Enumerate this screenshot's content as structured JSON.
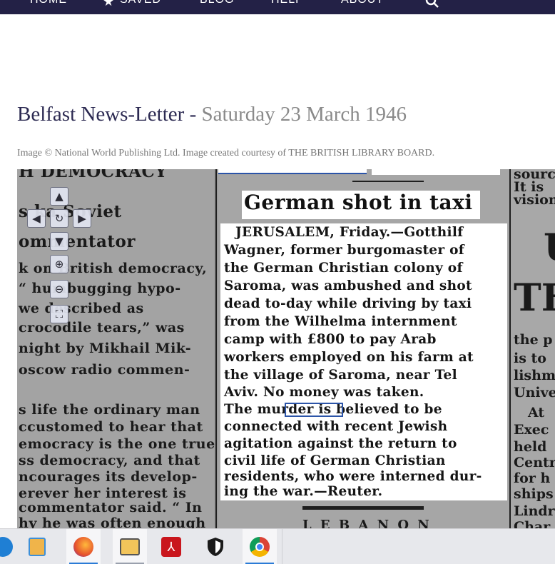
{
  "nav": {
    "items": [
      "HOME",
      "SAVED",
      "BLOG",
      "HELP",
      "ABOUT"
    ],
    "saved_icon": "star-icon",
    "search_icon": "search-icon"
  },
  "page": {
    "title": "Belfast News-Letter",
    "separator": " - ",
    "date": "Saturday 23 March 1946",
    "credit": "Image © National World Publishing Ltd. Image created courtesy of THE BRITISH LIBRARY BOARD."
  },
  "viewer": {
    "controls": {
      "up": "▲",
      "left": "◀",
      "reset": "↻",
      "right": "▶",
      "down": "▼",
      "zoom_in": "⊕",
      "zoom_out": "⊖",
      "fullscreen": "⛶"
    },
    "left_column": [
      "H  DEMOCRACY",
      "s  ka  Soviet",
      "ommentator",
      "k on British democracy,",
      "“  humbugging  hypo-",
      "we  described  as",
      "crocodile  tears,”  was",
      "night by Mikhail Mik-",
      "oscow  radio  commen-",
      "s life the ordinary man",
      "ccustomed to hear that",
      "emocracy is the one true",
      "ss democracy, and that",
      "ncourages  its  develop-",
      "erever  her  interest  is",
      "commentator said.  “ In",
      "hy he was often enough"
    ],
    "article": {
      "headline": "German shot in taxi",
      "lines": [
        "JERUSALEM, Friday.—Gotthilf",
        "Wagner,  former  burgomaster  of",
        "the  German  Christian  colony  of",
        "Saroma,  was  ambushed  and  shot",
        "dead  to-day  while  driving  by  taxi",
        "from   the   Wilhelma   internment",
        "camp  with  £800  to  pay  Arab",
        "workers  employed  on  his  farm  at",
        "the  village  of  Saroma,  near  Tel",
        "Aviv.  No money was taken.",
        "  The  murder  is  believed  to  be",
        "connected   with   recent   Jewish",
        "agitation  against  the  return  to",
        "civil  life  of  German  Christian",
        "residents,  who  were  interned  dur-",
        "ing the war.—Reuter."
      ]
    },
    "right_column": [
      "source",
      "It  is",
      "vision",
      "U",
      "TH",
      "the p",
      "is to",
      "lishm",
      "Unive",
      "At",
      "Exec",
      "held",
      "Centr",
      "for h",
      "ships",
      "Lindr",
      "Char"
    ],
    "bottom_fragment": "L E B A N O N"
  },
  "taskbar": {
    "apps": [
      "edge-icon",
      "media-player-icon",
      "firefox-icon",
      "mail-icon",
      "acrobat-icon",
      "security-icon",
      "chrome-icon"
    ]
  }
}
